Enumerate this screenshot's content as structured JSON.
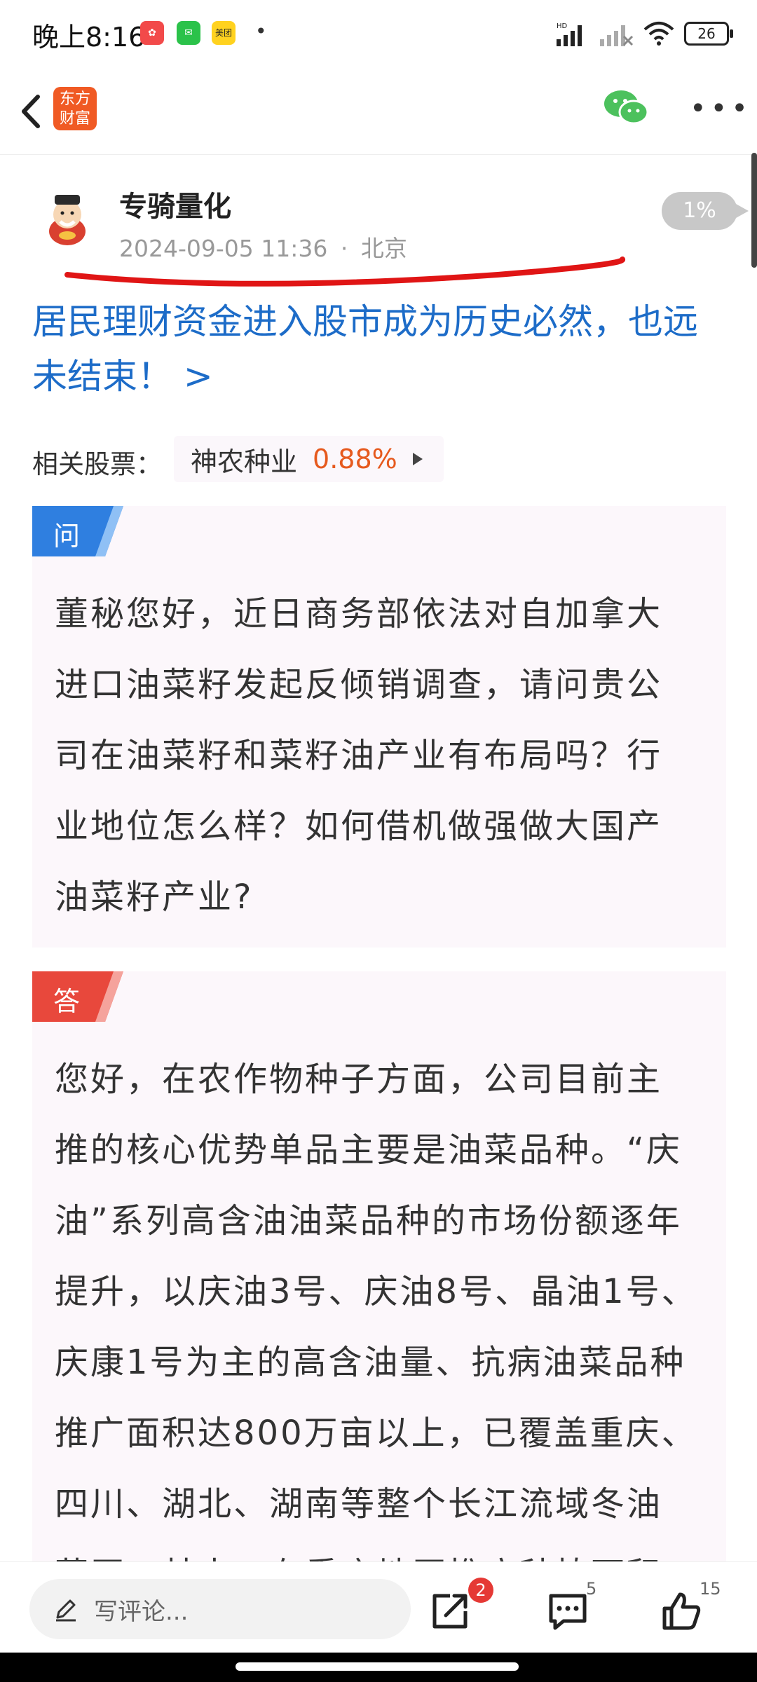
{
  "status": {
    "time": "晚上8:16",
    "app3": "美团",
    "dot": "•",
    "battery": "26"
  },
  "nav": {
    "logo_line1": "东方",
    "logo_line2": "财富"
  },
  "post": {
    "author": "专骑量化",
    "date": "2024-09-05 11:36",
    "sep": "·",
    "location": "北京",
    "read_progress": "1%",
    "title": "居民理财资金进入股市成为历史必然，也远未结束！ >"
  },
  "related": {
    "label": "相关股票：",
    "stock_name": "神农种业",
    "stock_change": "0.88%"
  },
  "question": {
    "tag": "问",
    "lines": [
      "董秘您好，近日商务部依法对自加拿大",
      "进口油菜籽发起反倾销调查，请问贵公",
      "司在油菜籽和菜籽油产业有布局吗？行",
      "业地位怎么样？如何借机做强做大国产",
      "油菜籽产业?"
    ]
  },
  "answer": {
    "tag": "答",
    "lines": [
      "您好，在农作物种子方面，公司目前主",
      "推的核心优势单品主要是油菜品种。“庆",
      "油”系列高含油油菜品种的市场份额逐年",
      "提升，以庆油3号、庆油8号、晶油1号、",
      "庆康1号为主的高含油量、抗病油菜品种",
      "推广面积达800万亩以上，已覆盖重庆、",
      "四川、湖北、湖南等整个长江流域冬油",
      "菜区，其中，在重庆地区推广种植面积"
    ]
  },
  "bottom": {
    "comment_placeholder": "写评论...",
    "share_badge": "2",
    "comment_count": "5",
    "like_count": "15"
  },
  "colors": {
    "accent_blue": "#1d6cc8",
    "stock_up": "#e65a1e",
    "question_tag": "#2f7fe0",
    "answer_tag": "#e8483c"
  }
}
